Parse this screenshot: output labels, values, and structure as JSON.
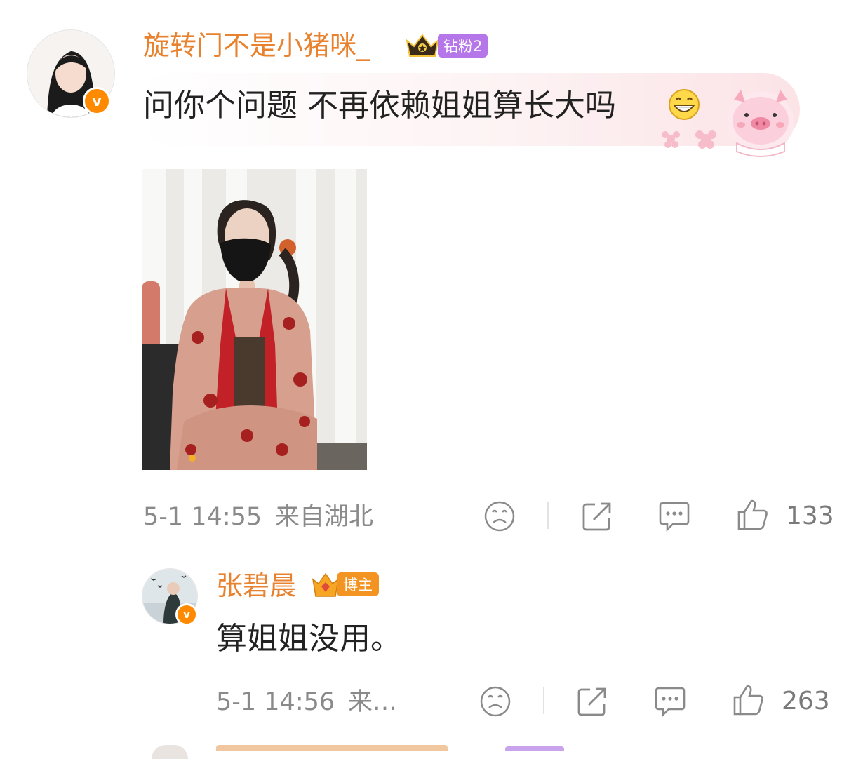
{
  "comments": [
    {
      "username": "旋转门不是小猪咪_",
      "fan_badge": "钻粉2",
      "text": "问你个问题 不再依赖姐姐算长大吗",
      "time": "5-1 14:55",
      "location": "来自湖北",
      "likes": "133"
    },
    {
      "username": "张碧晨",
      "role_badge": "博主",
      "text": "算姐姐没用。",
      "time": "5-1 14:56",
      "location": "来…",
      "likes": "263"
    }
  ],
  "colors": {
    "username": "#e8822f",
    "verified": "#ff8a00",
    "fan_badge": "#b476e8",
    "role_badge": "#f39422",
    "meta": "#8a8a8a"
  },
  "icons": [
    "verified-v-icon",
    "crown-icon",
    "sad-face-icon",
    "share-icon",
    "comment-icon",
    "thumbs-up-icon",
    "grin-emoji-icon",
    "pig-sticker-icon"
  ]
}
